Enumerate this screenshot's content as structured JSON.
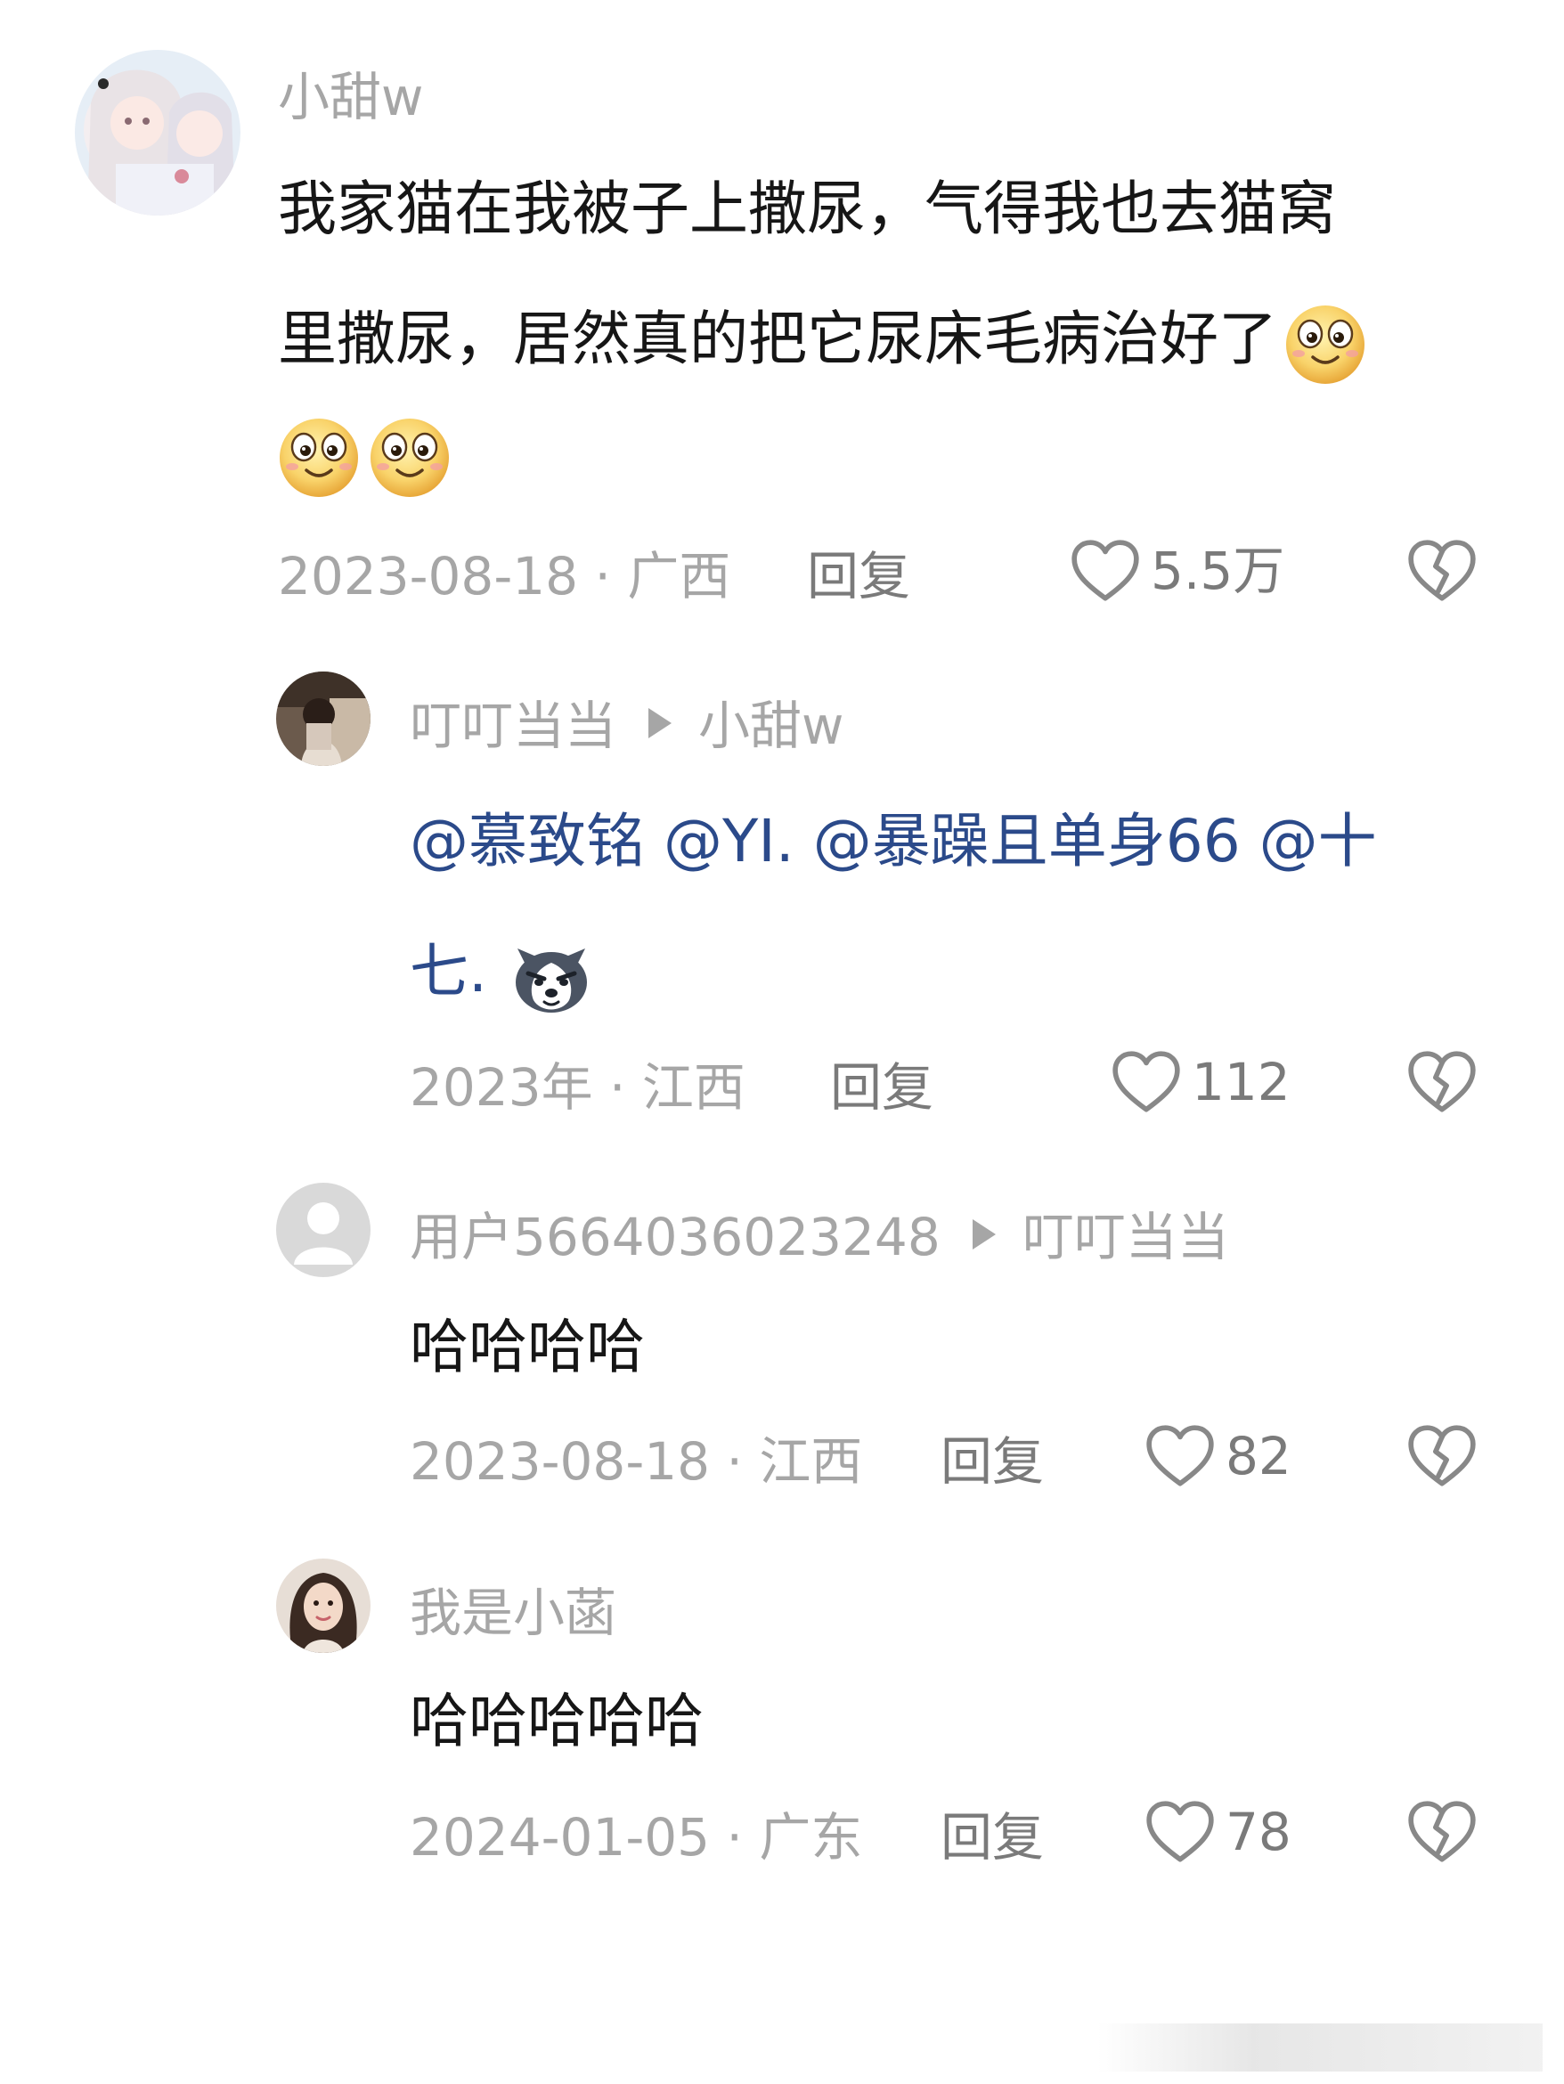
{
  "comments": [
    {
      "username": "小甜w",
      "text_line1": "我家猫在我被子上撒尿，气得我也去猫窝",
      "text_line2": "里撒尿，居然真的把它尿床毛病治好了",
      "date_location": "2023-08-18 · 广西",
      "reply_label": "回复",
      "likes": "5.5万"
    },
    {
      "username": "叮叮当当",
      "reply_to": "小甜w",
      "text_line1": "@慕致铭 @YI. @暴躁且单身66 @十",
      "text_line2": "七.",
      "date_location": "2023年 · 江西",
      "reply_label": "回复",
      "likes": "112"
    },
    {
      "username": "用户5664036023248",
      "reply_to": "叮叮当当",
      "text": "哈哈哈哈",
      "date_location": "2023-08-18 · 江西",
      "reply_label": "回复",
      "likes": "82"
    },
    {
      "username": "我是小菡",
      "text": "哈哈哈哈哈",
      "date_location": "2024-01-05 · 广东",
      "reply_label": "回复",
      "likes": "78"
    }
  ],
  "colors": {
    "mention": "#2b4a8a",
    "meta_gray": "#a6a6a6",
    "text": "#161616"
  },
  "icons": [
    "heart-icon",
    "broken-heart-icon",
    "smiley-emoji",
    "husky-emoji",
    "default-avatar-icon"
  ]
}
